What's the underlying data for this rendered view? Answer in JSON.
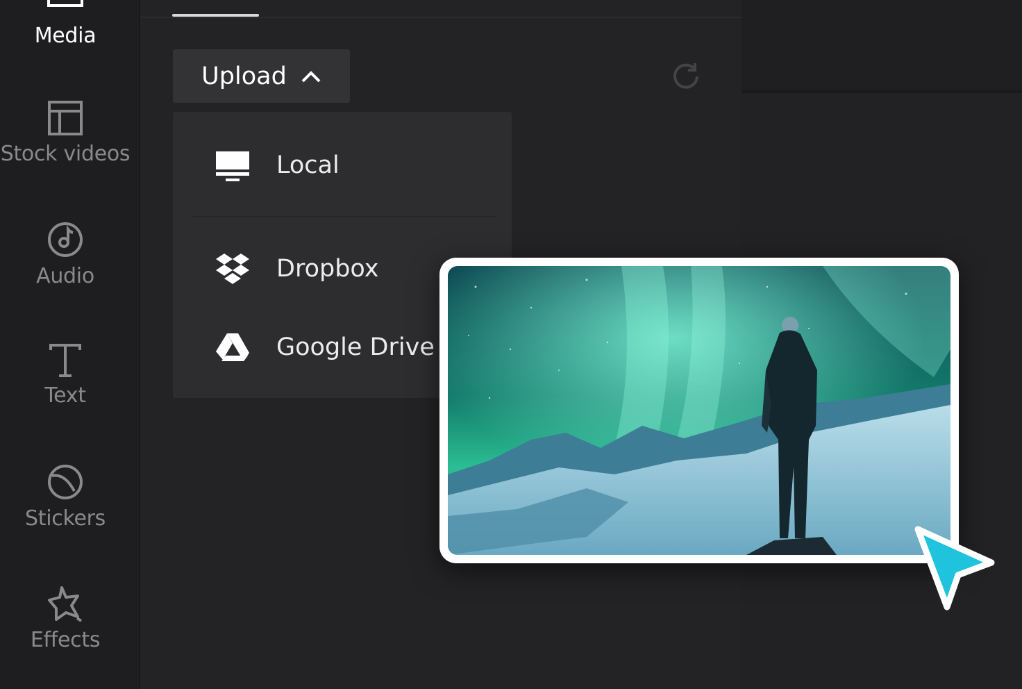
{
  "sidebar": {
    "items": [
      {
        "label": "Media",
        "icon": "media-icon",
        "active": true
      },
      {
        "label": "Stock videos",
        "icon": "stock-videos-icon"
      },
      {
        "label": "Audio",
        "icon": "audio-icon"
      },
      {
        "label": "Text",
        "icon": "text-icon"
      },
      {
        "label": "Stickers",
        "icon": "stickers-icon"
      },
      {
        "label": "Effects",
        "icon": "effects-icon"
      }
    ]
  },
  "toolbar": {
    "upload_label": "Upload",
    "upload_icon": "chevron-up-icon",
    "refresh_icon": "refresh-icon"
  },
  "upload_menu": {
    "items": [
      {
        "label": "Local",
        "icon": "monitor-icon"
      },
      {
        "label": "Dropbox",
        "icon": "dropbox-icon"
      },
      {
        "label": "Google Drive",
        "icon": "google-drive-icon"
      }
    ]
  },
  "preview": {
    "image": "aurora-landscape-photo",
    "cursor_icon": "pointer-cursor-icon"
  },
  "colors": {
    "background": "#222224",
    "sidebar": "#1e1e20",
    "menu": "#2d2d30",
    "accent_cursor": "#1fc3dd"
  }
}
